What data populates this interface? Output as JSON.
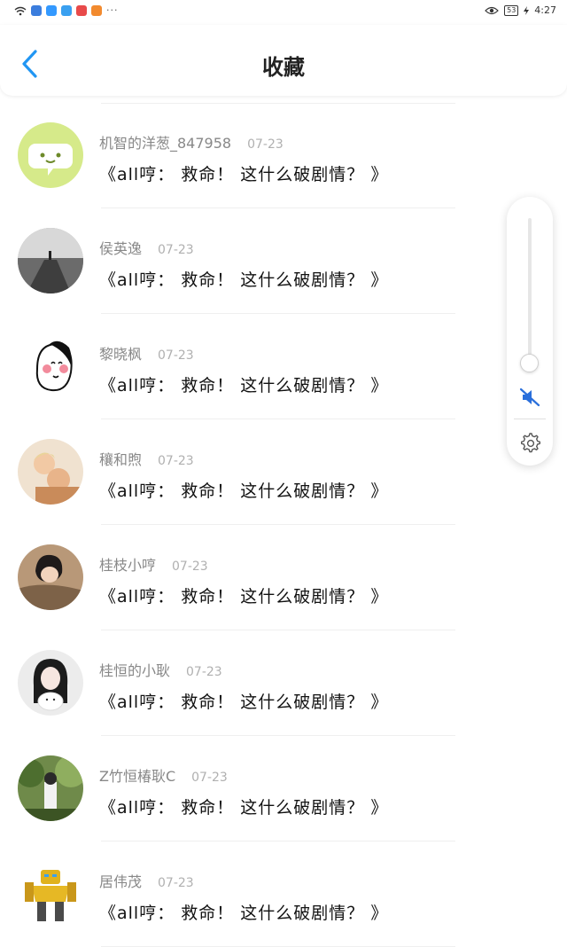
{
  "status_bar": {
    "time": "4:27",
    "battery": "53",
    "more_indicator": "···",
    "app_colors": [
      "#3b7ddd",
      "#3399ff",
      "#3aa0f0",
      "#e84a4a",
      "#f28a2e"
    ]
  },
  "header": {
    "title": "收藏",
    "accent_color": "#2196f3"
  },
  "items": [
    {
      "username": "机智的洋葱_847958",
      "date": "07-23",
      "message": "《all哼： 救命！ 这什么破剧情？ 》"
    },
    {
      "username": "侯英逸",
      "date": "07-23",
      "message": "《all哼： 救命！ 这什么破剧情？ 》"
    },
    {
      "username": "黎晓枫",
      "date": "07-23",
      "message": "《all哼： 救命！ 这什么破剧情？ 》"
    },
    {
      "username": "穰和煦",
      "date": "07-23",
      "message": "《all哼： 救命！ 这什么破剧情？ 》"
    },
    {
      "username": "桂枝小哼",
      "date": "07-23",
      "message": "《all哼： 救命！ 这什么破剧情？ 》"
    },
    {
      "username": "桂恒的小耿",
      "date": "07-23",
      "message": "《all哼： 救命！ 这什么破剧情？ 》"
    },
    {
      "username": "Z竹恒椿耿C",
      "date": "07-23",
      "message": "《all哼： 救命！ 这什么破剧情？ 》"
    },
    {
      "username": "居伟茂",
      "date": "07-23",
      "message": "《all哼： 救命！ 这什么破剧情？ 》"
    }
  ],
  "volume_panel": {
    "level_fraction": 0.05,
    "muted": true
  }
}
